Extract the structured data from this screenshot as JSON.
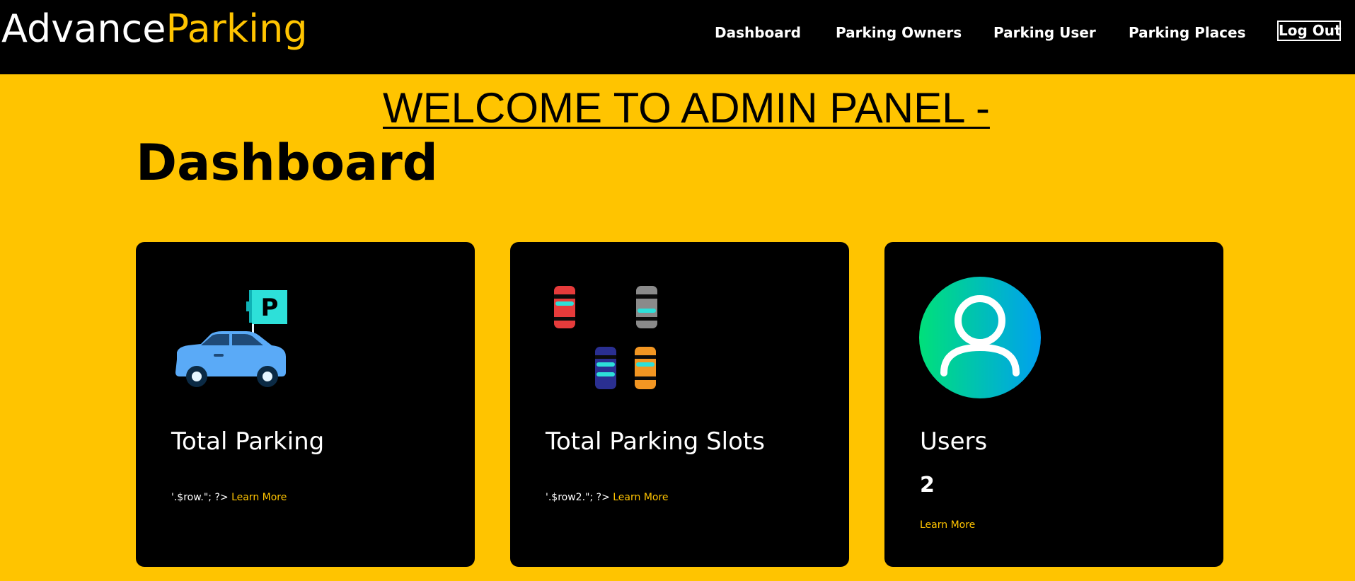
{
  "brand": {
    "part1": "Advance",
    "part2": "Parking"
  },
  "nav": {
    "items": [
      {
        "label": "Dashboard"
      },
      {
        "label": "Parking Owners"
      },
      {
        "label": "Parking User"
      },
      {
        "label": "Parking Places"
      }
    ],
    "logout": "Log Out"
  },
  "header": {
    "welcome": "WELCOME TO ADMIN PANEL -",
    "title": "Dashboard"
  },
  "cards": [
    {
      "icon": "car-parking-icon",
      "title": "Total Parking",
      "raw_text": "'.$row.\"; ?>",
      "link": "Learn More"
    },
    {
      "icon": "parking-slots-icon",
      "title": "Total Parking Slots",
      "raw_text": "'.$row2.\"; ?>",
      "link": "Learn More"
    },
    {
      "icon": "user-icon",
      "title": "Users",
      "count": "2",
      "link": "Learn More"
    }
  ],
  "colors": {
    "accent": "#FFC400",
    "nav_bg": "#000000",
    "card_bg": "#000000"
  }
}
